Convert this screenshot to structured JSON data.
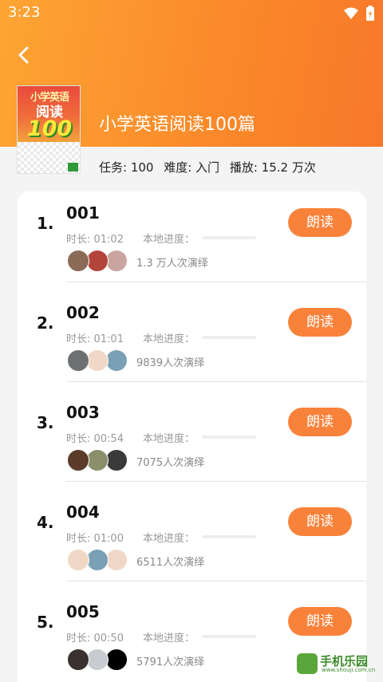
{
  "status": {
    "time": "3:23"
  },
  "book": {
    "title": "小学英语阅读100篇",
    "cover": {
      "line1": "小学英语",
      "line2": "阅读",
      "number": "100"
    },
    "meta": {
      "tasks": "任务: 100",
      "difficulty": "难度: 入门",
      "plays": "播放: 15.2 万次"
    }
  },
  "labels": {
    "read": "朗读",
    "progress": "本地进度："
  },
  "lessons": [
    {
      "index": "1.",
      "title": "001",
      "duration": "时长: 01:02",
      "plays": "1.3 万人次演绎",
      "progress": 0,
      "avatars": [
        "#8b6a57",
        "#b3443a",
        "#caa5a0"
      ]
    },
    {
      "index": "2.",
      "title": "002",
      "duration": "时长: 01:01",
      "plays": "9839人次演绎",
      "progress": 0,
      "avatars": [
        "#6c7070",
        "#f1d8c6",
        "#7aa0b6"
      ]
    },
    {
      "index": "3.",
      "title": "003",
      "duration": "时长: 00:54",
      "plays": "7075人次演绎",
      "progress": 0,
      "avatars": [
        "#5b3b2a",
        "#8a8f6a",
        "#3a3a3a"
      ]
    },
    {
      "index": "4.",
      "title": "004",
      "duration": "时长: 01:00",
      "plays": "6511人次演绎",
      "progress": 0,
      "avatars": [
        "#f1d8c6",
        "#7aa0b6",
        "#f1d8c6"
      ]
    },
    {
      "index": "5.",
      "title": "005",
      "duration": "时长: 00:50",
      "plays": "5791人次演绎",
      "progress": 0,
      "avatars": [
        "#3a3030",
        "#c8ccd0",
        "#000000"
      ]
    }
  ],
  "watermark": {
    "text": "手机乐园",
    "url": "www.shouji.com.cn"
  }
}
